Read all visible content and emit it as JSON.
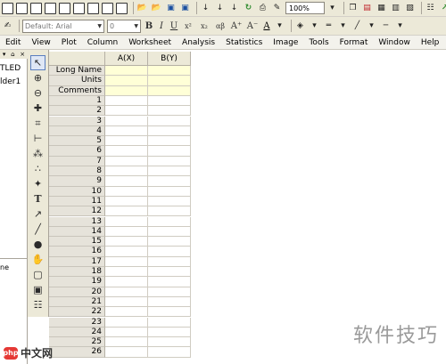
{
  "toolbar1": {
    "zoom": "100%",
    "icons": [
      "new-project",
      "new-folder",
      "new-worksheet",
      "new-graph",
      "new-matrix",
      "new-excel",
      "new-layout",
      "new-function",
      "new-notes",
      "open",
      "open-template",
      "save-project",
      "save-template",
      "import-ascii",
      "import-wizard",
      "import-excel",
      "recalc",
      "print",
      "zoom-in",
      "redraw",
      "script-window",
      "code-builder",
      "results-log",
      "command-window",
      "project-explorer"
    ]
  },
  "toolbar2": {
    "font_family": "Default: Arial",
    "font_size": "0",
    "bold": "B",
    "italic": "I",
    "underline": "U",
    "superscript": "x²",
    "subscript": "x₂",
    "greek": "αβ",
    "increase_font": "A⁺",
    "decrease_font": "A⁻",
    "font_color": "A"
  },
  "menu": [
    "Edit",
    "View",
    "Plot",
    "Column",
    "Worksheet",
    "Analysis",
    "Statistics",
    "Image",
    "Tools",
    "Format",
    "Window",
    "Help"
  ],
  "project": {
    "root": "TLED",
    "folder": "lder1",
    "bottom": "ne"
  },
  "tools": [
    "pointer",
    "zoom-in",
    "zoom-out",
    "screen-reader",
    "data-reader",
    "data-selector",
    "draw-data",
    "mask",
    "text",
    "arrow",
    "line",
    "rectangle",
    "region-zoom",
    "add-graph",
    "new-layer",
    "object-edit",
    "merge"
  ],
  "worksheet": {
    "columns": [
      "A(X)",
      "B(Y)"
    ],
    "meta_rows": [
      "Long Name",
      "Units",
      "Comments"
    ],
    "rows": [
      "1",
      "2",
      "3",
      "4",
      "5",
      "6",
      "7",
      "8",
      "9",
      "10",
      "11",
      "12",
      "13",
      "14",
      "15",
      "16",
      "17",
      "18",
      "19",
      "20",
      "21",
      "22",
      "23",
      "24",
      "25",
      "26"
    ]
  },
  "watermark": "软件技巧",
  "logo": {
    "mark": "php",
    "text": "中文网"
  }
}
